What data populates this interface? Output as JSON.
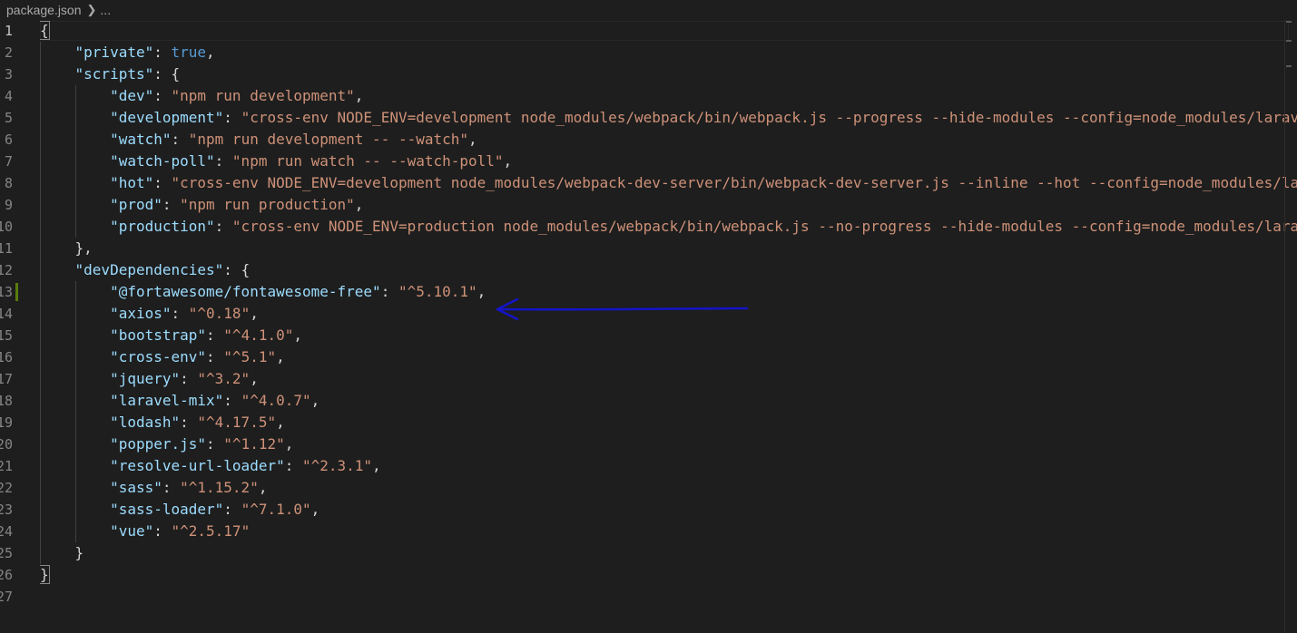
{
  "breadcrumb": {
    "file": "package.json",
    "more": "..."
  },
  "editor": {
    "line_numbers": [
      "1",
      "2",
      "3",
      "4",
      "5",
      "6",
      "7",
      "8",
      "9",
      "10",
      "11",
      "12",
      "13",
      "14",
      "15",
      "16",
      "17",
      "18",
      "19",
      "20",
      "21",
      "22",
      "23",
      "24",
      "25",
      "26",
      "27"
    ],
    "lines": [
      [
        {
          "t": "p",
          "v": "{"
        }
      ],
      [
        {
          "t": "p",
          "v": "    "
        },
        {
          "t": "k",
          "v": "\"private\""
        },
        {
          "t": "p",
          "v": ": "
        },
        {
          "t": "b",
          "v": "true"
        },
        {
          "t": "p",
          "v": ","
        }
      ],
      [
        {
          "t": "p",
          "v": "    "
        },
        {
          "t": "k",
          "v": "\"scripts\""
        },
        {
          "t": "p",
          "v": ": {"
        }
      ],
      [
        {
          "t": "p",
          "v": "        "
        },
        {
          "t": "k",
          "v": "\"dev\""
        },
        {
          "t": "p",
          "v": ": "
        },
        {
          "t": "s",
          "v": "\"npm run development\""
        },
        {
          "t": "p",
          "v": ","
        }
      ],
      [
        {
          "t": "p",
          "v": "        "
        },
        {
          "t": "k",
          "v": "\"development\""
        },
        {
          "t": "p",
          "v": ": "
        },
        {
          "t": "s",
          "v": "\"cross-env NODE_ENV=development node_modules/webpack/bin/webpack.js --progress --hide-modules --config=node_modules/laravel-mix/setup/webpack.config.js\""
        },
        {
          "t": "p",
          "v": ","
        }
      ],
      [
        {
          "t": "p",
          "v": "        "
        },
        {
          "t": "k",
          "v": "\"watch\""
        },
        {
          "t": "p",
          "v": ": "
        },
        {
          "t": "s",
          "v": "\"npm run development -- --watch\""
        },
        {
          "t": "p",
          "v": ","
        }
      ],
      [
        {
          "t": "p",
          "v": "        "
        },
        {
          "t": "k",
          "v": "\"watch-poll\""
        },
        {
          "t": "p",
          "v": ": "
        },
        {
          "t": "s",
          "v": "\"npm run watch -- --watch-poll\""
        },
        {
          "t": "p",
          "v": ","
        }
      ],
      [
        {
          "t": "p",
          "v": "        "
        },
        {
          "t": "k",
          "v": "\"hot\""
        },
        {
          "t": "p",
          "v": ": "
        },
        {
          "t": "s",
          "v": "\"cross-env NODE_ENV=development node_modules/webpack-dev-server/bin/webpack-dev-server.js --inline --hot --config=node_modules/laravel-mix/setup/webpack.config.js\""
        },
        {
          "t": "p",
          "v": ","
        }
      ],
      [
        {
          "t": "p",
          "v": "        "
        },
        {
          "t": "k",
          "v": "\"prod\""
        },
        {
          "t": "p",
          "v": ": "
        },
        {
          "t": "s",
          "v": "\"npm run production\""
        },
        {
          "t": "p",
          "v": ","
        }
      ],
      [
        {
          "t": "p",
          "v": "        "
        },
        {
          "t": "k",
          "v": "\"production\""
        },
        {
          "t": "p",
          "v": ": "
        },
        {
          "t": "s",
          "v": "\"cross-env NODE_ENV=production node_modules/webpack/bin/webpack.js --no-progress --hide-modules --config=node_modules/laravel-mix/setup/webpack.config.js\""
        }
      ],
      [
        {
          "t": "p",
          "v": "    },"
        }
      ],
      [
        {
          "t": "p",
          "v": "    "
        },
        {
          "t": "k",
          "v": "\"devDependencies\""
        },
        {
          "t": "p",
          "v": ": {"
        }
      ],
      [
        {
          "t": "p",
          "v": "        "
        },
        {
          "t": "k",
          "v": "\"@fortawesome/fontawesome-free\""
        },
        {
          "t": "p",
          "v": ": "
        },
        {
          "t": "s",
          "v": "\"^5.10.1\""
        },
        {
          "t": "p",
          "v": ","
        }
      ],
      [
        {
          "t": "p",
          "v": "        "
        },
        {
          "t": "k",
          "v": "\"axios\""
        },
        {
          "t": "p",
          "v": ": "
        },
        {
          "t": "s",
          "v": "\"^0.18\""
        },
        {
          "t": "p",
          "v": ","
        }
      ],
      [
        {
          "t": "p",
          "v": "        "
        },
        {
          "t": "k",
          "v": "\"bootstrap\""
        },
        {
          "t": "p",
          "v": ": "
        },
        {
          "t": "s",
          "v": "\"^4.1.0\""
        },
        {
          "t": "p",
          "v": ","
        }
      ],
      [
        {
          "t": "p",
          "v": "        "
        },
        {
          "t": "k",
          "v": "\"cross-env\""
        },
        {
          "t": "p",
          "v": ": "
        },
        {
          "t": "s",
          "v": "\"^5.1\""
        },
        {
          "t": "p",
          "v": ","
        }
      ],
      [
        {
          "t": "p",
          "v": "        "
        },
        {
          "t": "k",
          "v": "\"jquery\""
        },
        {
          "t": "p",
          "v": ": "
        },
        {
          "t": "s",
          "v": "\"^3.2\""
        },
        {
          "t": "p",
          "v": ","
        }
      ],
      [
        {
          "t": "p",
          "v": "        "
        },
        {
          "t": "k",
          "v": "\"laravel-mix\""
        },
        {
          "t": "p",
          "v": ": "
        },
        {
          "t": "s",
          "v": "\"^4.0.7\""
        },
        {
          "t": "p",
          "v": ","
        }
      ],
      [
        {
          "t": "p",
          "v": "        "
        },
        {
          "t": "k",
          "v": "\"lodash\""
        },
        {
          "t": "p",
          "v": ": "
        },
        {
          "t": "s",
          "v": "\"^4.17.5\""
        },
        {
          "t": "p",
          "v": ","
        }
      ],
      [
        {
          "t": "p",
          "v": "        "
        },
        {
          "t": "k",
          "v": "\"popper.js\""
        },
        {
          "t": "p",
          "v": ": "
        },
        {
          "t": "s",
          "v": "\"^1.12\""
        },
        {
          "t": "p",
          "v": ","
        }
      ],
      [
        {
          "t": "p",
          "v": "        "
        },
        {
          "t": "k",
          "v": "\"resolve-url-loader\""
        },
        {
          "t": "p",
          "v": ": "
        },
        {
          "t": "s",
          "v": "\"^2.3.1\""
        },
        {
          "t": "p",
          "v": ","
        }
      ],
      [
        {
          "t": "p",
          "v": "        "
        },
        {
          "t": "k",
          "v": "\"sass\""
        },
        {
          "t": "p",
          "v": ": "
        },
        {
          "t": "s",
          "v": "\"^1.15.2\""
        },
        {
          "t": "p",
          "v": ","
        }
      ],
      [
        {
          "t": "p",
          "v": "        "
        },
        {
          "t": "k",
          "v": "\"sass-loader\""
        },
        {
          "t": "p",
          "v": ": "
        },
        {
          "t": "s",
          "v": "\"^7.1.0\""
        },
        {
          "t": "p",
          "v": ","
        }
      ],
      [
        {
          "t": "p",
          "v": "        "
        },
        {
          "t": "k",
          "v": "\"vue\""
        },
        {
          "t": "p",
          "v": ": "
        },
        {
          "t": "s",
          "v": "\"^2.5.17\""
        }
      ],
      [
        {
          "t": "p",
          "v": "    }"
        }
      ],
      [
        {
          "t": "p",
          "v": "}"
        }
      ],
      []
    ],
    "active_line": "1",
    "modified_line": "13",
    "annotation": {
      "type": "hand-drawn arrow",
      "color": "#1414c8",
      "points_to_line": "13"
    }
  }
}
